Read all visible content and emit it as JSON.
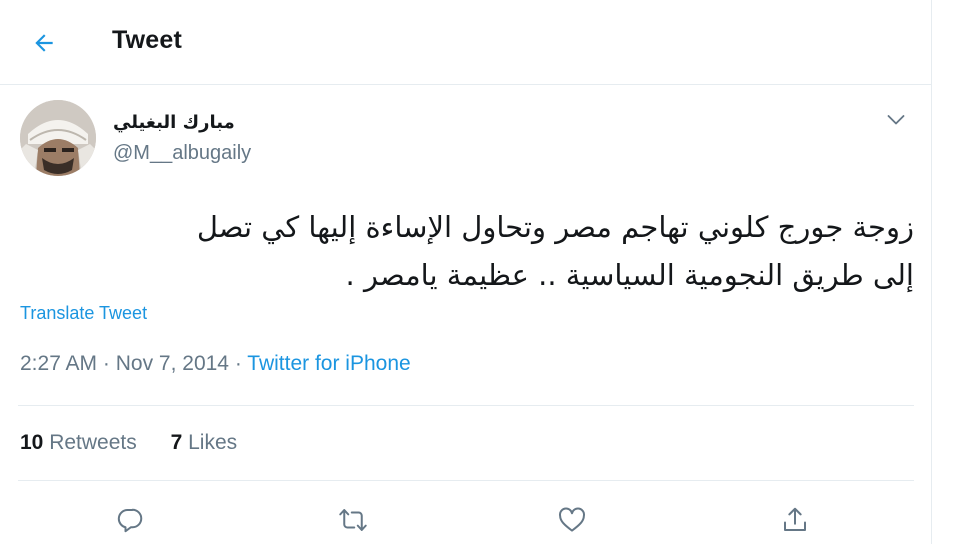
{
  "header": {
    "title": "Tweet",
    "back_icon": "arrow-left-icon"
  },
  "tweet": {
    "author_name": "مبارك البغيلي",
    "author_handle": "@M__albugaily",
    "text_line1": "زوجة جورج كلوني تهاجم مصر وتحاول الإساءة إليها كي تصل",
    "text_line2": "إلى طريق النجومية السياسية .. عظيمة يامصر .",
    "translate_label": "Translate Tweet",
    "time": "2:27 AM",
    "separator": " · ",
    "date": "Nov 7, 2014",
    "source": "Twitter for iPhone",
    "retweets_count": "10",
    "retweets_label": "Retweets",
    "likes_count": "7",
    "likes_label": "Likes"
  },
  "colors": {
    "accent": "#1b95e0",
    "text": "#14171a",
    "muted": "#657786",
    "border": "#e6ecf0"
  },
  "actions": [
    "reply-icon",
    "retweet-icon",
    "like-icon",
    "share-icon"
  ]
}
